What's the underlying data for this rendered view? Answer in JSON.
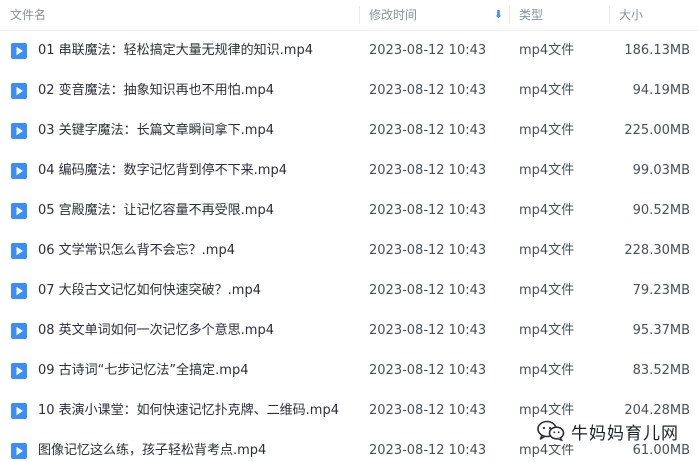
{
  "header": {
    "name_label": "文件名",
    "date_label": "修改时间",
    "sort_icon": "down-arrow-icon",
    "type_label": "类型",
    "size_label": "大小"
  },
  "files": [
    {
      "name": "01 串联魔法：轻松搞定大量无规律的知识.mp4",
      "date": "2023-08-12 10:43",
      "type": "mp4文件",
      "size": "186.13MB"
    },
    {
      "name": "02 变音魔法：抽象知识再也不用怕.mp4",
      "date": "2023-08-12 10:43",
      "type": "mp4文件",
      "size": "94.19MB"
    },
    {
      "name": "03 关键字魔法：长篇文章瞬间拿下.mp4",
      "date": "2023-08-12 10:43",
      "type": "mp4文件",
      "size": "225.00MB"
    },
    {
      "name": "04 编码魔法：数字记忆背到停不下来.mp4",
      "date": "2023-08-12 10:43",
      "type": "mp4文件",
      "size": "99.03MB"
    },
    {
      "name": "05 宫殿魔法：让记忆容量不再受限.mp4",
      "date": "2023-08-12 10:43",
      "type": "mp4文件",
      "size": "90.52MB"
    },
    {
      "name": "06 文学常识怎么背不会忘？.mp4",
      "date": "2023-08-12 10:43",
      "type": "mp4文件",
      "size": "228.30MB"
    },
    {
      "name": "07 大段古文记忆如何快速突破？.mp4",
      "date": "2023-08-12 10:43",
      "type": "mp4文件",
      "size": "79.23MB"
    },
    {
      "name": "08 英文单词如何一次记忆多个意思.mp4",
      "date": "2023-08-12 10:43",
      "type": "mp4文件",
      "size": "95.37MB"
    },
    {
      "name": "09 古诗词“七步记忆法”全搞定.mp4",
      "date": "2023-08-12 10:43",
      "type": "mp4文件",
      "size": "83.52MB"
    },
    {
      "name": "10 表演小课堂：如何快速记忆扑克牌、二维码.mp4",
      "date": "2023-08-12 10:43",
      "type": "mp4文件",
      "size": "204.28MB"
    },
    {
      "name": "图像记忆这么练，孩子轻松背考点.mp4",
      "date": "2023-08-12 10:43",
      "type": "mp4文件",
      "size": "61.00MB"
    }
  ],
  "file_icon": "video-file-icon",
  "colors": {
    "icon_blue": "#3a8ef6",
    "header_text": "#8a929e",
    "sort_arrow": "#3b8cff"
  },
  "watermark": {
    "text": "牛妈妈育儿网",
    "icon": "wechat-icon"
  }
}
